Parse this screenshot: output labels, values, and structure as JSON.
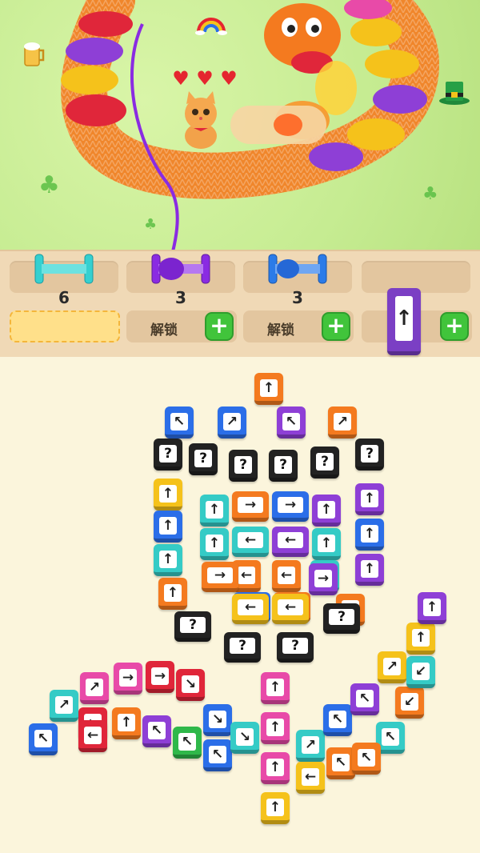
{
  "hud": {
    "hearts": [
      "♥",
      "♥",
      "♥"
    ],
    "heart_color": "#e5262f"
  },
  "spool_slots": [
    {
      "color": "#35d0d0",
      "count": "6"
    },
    {
      "color": "#8a2be2",
      "count": "3"
    },
    {
      "color": "#2b7be8",
      "count": "3"
    },
    {
      "color": "",
      "count": ""
    }
  ],
  "unlock": {
    "label": "解锁",
    "plus": "+"
  },
  "pending_tile": {
    "color": "#7b3fc4",
    "arrow": "↑"
  },
  "tiles": [
    {
      "color": "#f47a1f",
      "arrow": "↑"
    },
    {
      "color": "#2b6ee8",
      "arrow": "↖"
    },
    {
      "color": "#2b6ee8",
      "arrow": "↗"
    },
    {
      "color": "#8e3fd6",
      "arrow": "↖"
    },
    {
      "color": "#f47a1f",
      "arrow": "↗"
    },
    {
      "color": "#222222",
      "arrow": "?"
    },
    {
      "color": "#222222",
      "arrow": "?"
    },
    {
      "color": "#222222",
      "arrow": "?"
    },
    {
      "color": "#222222",
      "arrow": "?"
    },
    {
      "color": "#222222",
      "arrow": "?"
    },
    {
      "color": "#222222",
      "arrow": "?"
    },
    {
      "color": "#f5c21b",
      "arrow": "↑"
    },
    {
      "color": "#35cbc6",
      "arrow": "↑"
    },
    {
      "color": "#f47a1f",
      "arrow": "→"
    },
    {
      "color": "#2b6ee8",
      "arrow": "→"
    },
    {
      "color": "#8e3fd6",
      "arrow": "↑"
    },
    {
      "color": "#8e3fd6",
      "arrow": "↑"
    },
    {
      "color": "#2b6ee8",
      "arrow": "↑"
    },
    {
      "color": "#35cbc6",
      "arrow": "↑"
    },
    {
      "color": "#35cbc6",
      "arrow": "←"
    },
    {
      "color": "#8e3fd6",
      "arrow": "←"
    },
    {
      "color": "#35cbc6",
      "arrow": "↑"
    },
    {
      "color": "#2b6ee8",
      "arrow": "↑"
    },
    {
      "color": "#35cbc6",
      "arrow": "↑"
    },
    {
      "color": "#f47a1f",
      "arrow": "←"
    },
    {
      "color": "#f47a1f",
      "arrow": "←"
    },
    {
      "color": "#35cbc6",
      "arrow": "↑"
    },
    {
      "color": "#8e3fd6",
      "arrow": "↑"
    },
    {
      "color": "#f47a1f",
      "arrow": "→"
    },
    {
      "color": "#2b6ee8",
      "arrow": "→"
    },
    {
      "color": "#f47a1f",
      "arrow": "→"
    },
    {
      "color": "#8e3fd6",
      "arrow": "→"
    },
    {
      "color": "#f47a1f",
      "arrow": "↑"
    },
    {
      "color": "#f5c21b",
      "arrow": "←"
    },
    {
      "color": "#f5c21b",
      "arrow": "←"
    },
    {
      "color": "#f47a1f",
      "arrow": "↗"
    },
    {
      "color": "#222222",
      "arrow": "?"
    },
    {
      "color": "#222222",
      "arrow": "?"
    },
    {
      "color": "#222222",
      "arrow": "?"
    },
    {
      "color": "#222222",
      "arrow": "?"
    },
    {
      "color": "#e84aa8",
      "arrow": "↑"
    },
    {
      "color": "#e84aa8",
      "arrow": "↑"
    },
    {
      "color": "#e84aa8",
      "arrow": "↑"
    },
    {
      "color": "#f5c21b",
      "arrow": "↑"
    },
    {
      "color": "#2b6ee8",
      "arrow": "↖"
    },
    {
      "color": "#e0263a",
      "arrow": "←"
    },
    {
      "color": "#35cbc6",
      "arrow": "↗"
    },
    {
      "color": "#e84aa8",
      "arrow": "↗"
    },
    {
      "color": "#e84aa8",
      "arrow": "→"
    },
    {
      "color": "#e0263a",
      "arrow": "→"
    },
    {
      "color": "#e0263a",
      "arrow": "↘"
    },
    {
      "color": "#e0263a",
      "arrow": "←"
    },
    {
      "color": "#f47a1f",
      "arrow": "↑"
    },
    {
      "color": "#8e3fd6",
      "arrow": "↖"
    },
    {
      "color": "#2fb84a",
      "arrow": "↖"
    },
    {
      "color": "#2b6ee8",
      "arrow": "↖"
    },
    {
      "color": "#2b6ee8",
      "arrow": "↘"
    },
    {
      "color": "#35cbc6",
      "arrow": "↘"
    },
    {
      "color": "#35cbc6",
      "arrow": "↗"
    },
    {
      "color": "#f5c21b",
      "arrow": "←"
    },
    {
      "color": "#f47a1f",
      "arrow": "↖"
    },
    {
      "color": "#2b6ee8",
      "arrow": "↖"
    },
    {
      "color": "#8e3fd6",
      "arrow": "↖"
    },
    {
      "color": "#35cbc6",
      "arrow": "↖"
    },
    {
      "color": "#f47a1f",
      "arrow": "↖"
    },
    {
      "color": "#f47a1f",
      "arrow": "↙"
    },
    {
      "color": "#f5c21b",
      "arrow": "↗"
    },
    {
      "color": "#35cbc6",
      "arrow": "↙"
    },
    {
      "color": "#f5c21b",
      "arrow": "↑"
    },
    {
      "color": "#8e3fd6",
      "arrow": "↑"
    }
  ]
}
